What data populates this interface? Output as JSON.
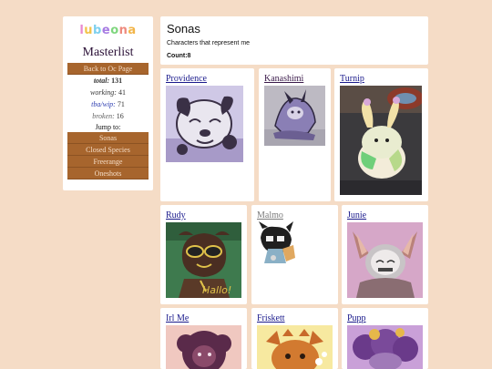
{
  "sidebar": {
    "logo_letters": [
      "l",
      "u",
      "b",
      "e",
      "o",
      "n",
      "a"
    ],
    "logo_colors": [
      "#e88ad0",
      "#f2c34a",
      "#7ed0ee",
      "#a77be2",
      "#7fd67e",
      "#ee8a7e",
      "#f2b54a"
    ],
    "title": "Masterlist",
    "back_button": "Back to Oc Page",
    "stats": [
      {
        "label": "total:",
        "value": "131"
      },
      {
        "label": "working:",
        "value": "41"
      },
      {
        "label": "tba/wip:",
        "value": "71"
      },
      {
        "label": "broken:",
        "value": "16"
      }
    ],
    "jump_label": "Jump to:",
    "jump_items": [
      "Sonas",
      "Closed Species",
      "Freerange",
      "Oneshots"
    ]
  },
  "header": {
    "title": "Sonas",
    "description": "Characters that represent me",
    "count": "Count:8"
  },
  "characters": [
    {
      "name": "Providence"
    },
    {
      "name": "Kanashimi"
    },
    {
      "name": "Turnip"
    },
    {
      "name": "Rudy",
      "caption": "Hallo!"
    },
    {
      "name": "Malmo"
    },
    {
      "name": "Junie"
    },
    {
      "name": "Irl Me"
    },
    {
      "name": "Friskett"
    },
    {
      "name": "Pupp"
    }
  ],
  "colors": {
    "background": "#f5dcc6",
    "button": "#a7652d",
    "link": "#1a1a8c"
  }
}
